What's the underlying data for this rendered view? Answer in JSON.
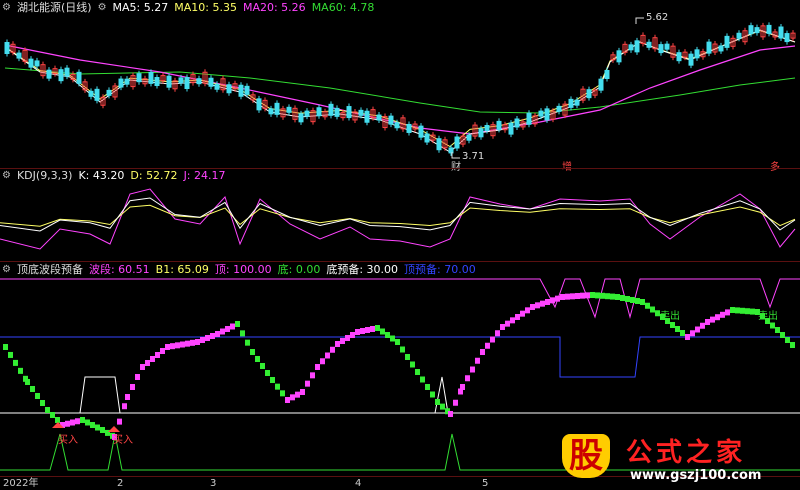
{
  "price_pane": {
    "symbol": "湖北能源(日线)",
    "ma": [
      {
        "label": "MA5: 5.27",
        "color": "#ffffff"
      },
      {
        "label": "MA10: 5.35",
        "color": "#ffff66"
      },
      {
        "label": "MA20: 5.26",
        "color": "#ff44ff"
      },
      {
        "label": "MA60: 4.78",
        "color": "#33dd33"
      }
    ],
    "high_label": "5.62",
    "low_label": "3.71",
    "marks": [
      "财",
      "增",
      "多"
    ]
  },
  "kdj_pane": {
    "title": "KDJ(9,3,3)",
    "k": "K: 43.20",
    "d": "D: 52.72",
    "j": "J: 24.17",
    "colors": {
      "k": "#ffffff",
      "d": "#ffff66",
      "j": "#ff44ff"
    }
  },
  "wave_pane": {
    "title": "顶底波段预备",
    "items": [
      {
        "label": "波段: 60.51",
        "color": "#ff44ff"
      },
      {
        "label": "B1: 65.09",
        "color": "#ffff66"
      },
      {
        "label": "顶: 100.00",
        "color": "#ff44ff"
      },
      {
        "label": "底: 0.00",
        "color": "#33dd33"
      },
      {
        "label": "底预备: 30.00",
        "color": "#ffffff"
      },
      {
        "label": "顶预备: 70.00",
        "color": "#3344ff"
      }
    ],
    "buy_labels": [
      "买入",
      "买入"
    ],
    "sell_labels": [
      "卖出",
      "卖出"
    ]
  },
  "x_axis": [
    "2022年",
    "2",
    "3",
    "4",
    "5"
  ],
  "watermark": {
    "logo": "股",
    "text": "公式之家",
    "url": "www.gszj100.com"
  }
}
